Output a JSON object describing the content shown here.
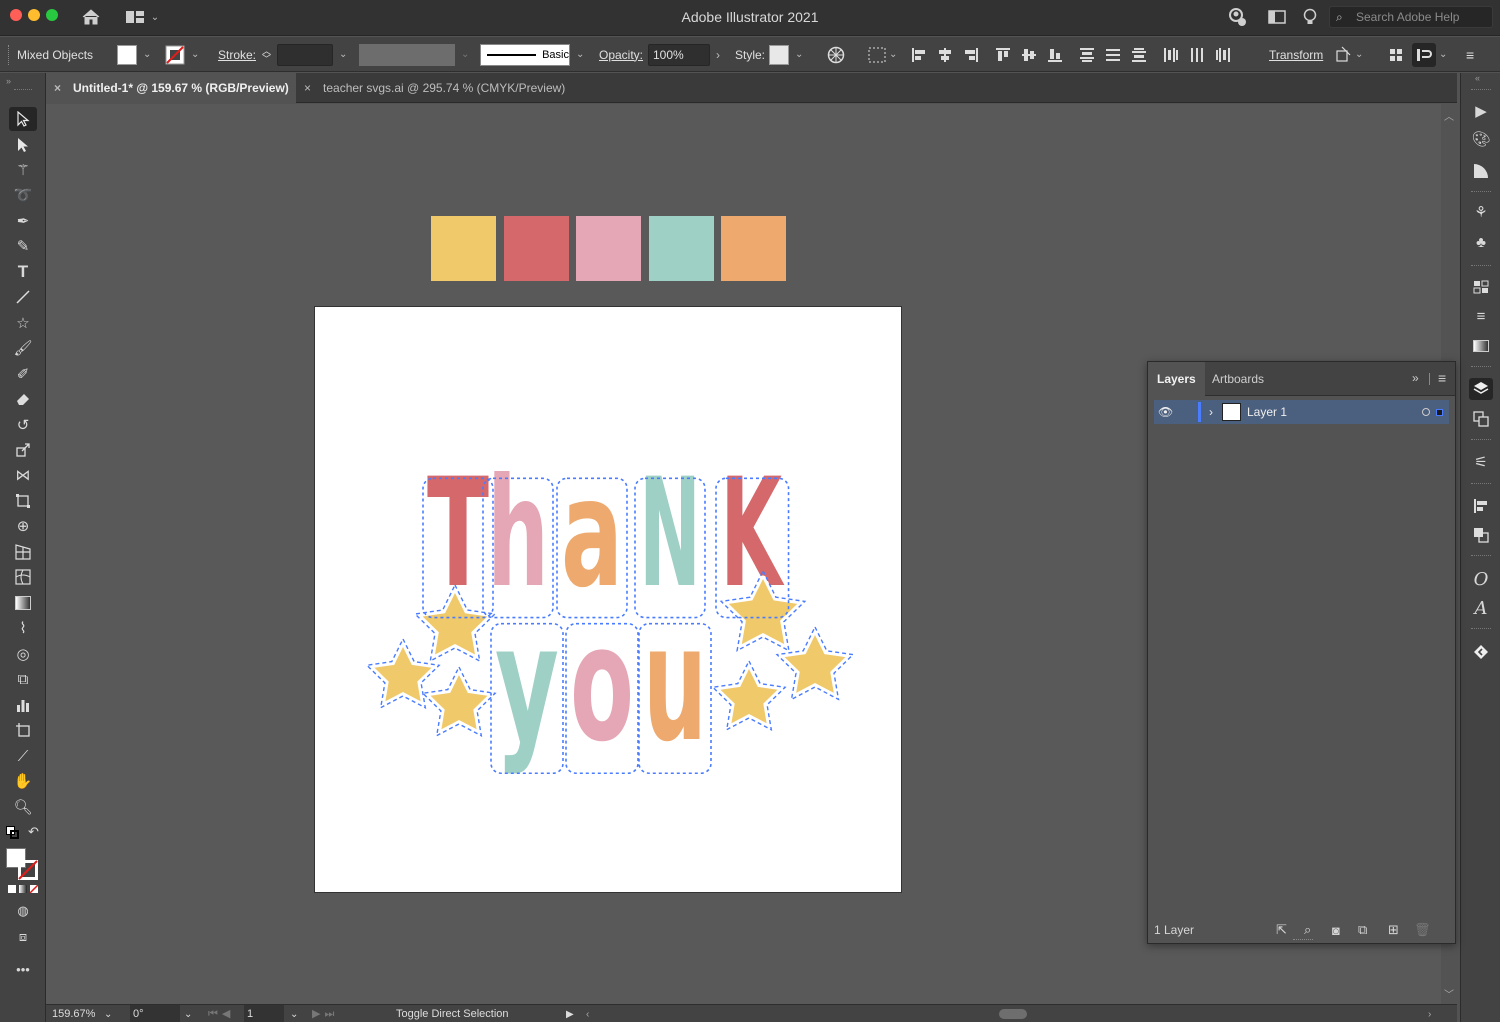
{
  "window": {
    "title": "Adobe Illustrator 2021",
    "colors": {
      "close": "#ff5f57",
      "minimize": "#febc2e",
      "zoom": "#28c840"
    }
  },
  "titlebar": {
    "search_placeholder": "Search Adobe Help",
    "icons": [
      "home-icon",
      "workspace-icon",
      "share-user-icon",
      "arrange-icon",
      "lightbulb-icon",
      "search-icon"
    ]
  },
  "control_bar": {
    "selection_label": "Mixed Objects",
    "stroke_label": "Stroke:",
    "brush_label": "Basic",
    "opacity_label": "Opacity:",
    "opacity_value": "100%",
    "style_label": "Style:",
    "transform_label": "Transform"
  },
  "tabs": [
    {
      "label": "Untitled-1* @ 159.67 % (RGB/Preview)",
      "active": true
    },
    {
      "label": "teacher svgs.ai @ 295.74 % (CMYK/Preview)",
      "active": false
    }
  ],
  "swatches": [
    "#EFC96A",
    "#D4686B",
    "#E5A6B6",
    "#9FD0C5",
    "#EEAA6E"
  ],
  "artwork": {
    "word1": [
      "T",
      "h",
      "a",
      "N",
      "K"
    ],
    "word2": [
      "y",
      "o",
      "u"
    ],
    "letter_colors": [
      "#D4686B",
      "#E5A6B6",
      "#EEAA6E",
      "#9FD0C5",
      "#D4686B",
      "#9FD0C5",
      "#E5A6B6",
      "#EEAA6E"
    ],
    "star_color": "#EFC96A",
    "selection_color": "#4a7cff"
  },
  "layers_panel": {
    "tab_layers": "Layers",
    "tab_artboards": "Artboards",
    "layer_name": "Layer 1",
    "footer_count": "1 Layer",
    "row_highlight": "#4b5f7e"
  },
  "status_bar": {
    "zoom": "159.67%",
    "rotation": "0°",
    "artboard_number": "1",
    "tool_hint": "Toggle Direct Selection"
  }
}
